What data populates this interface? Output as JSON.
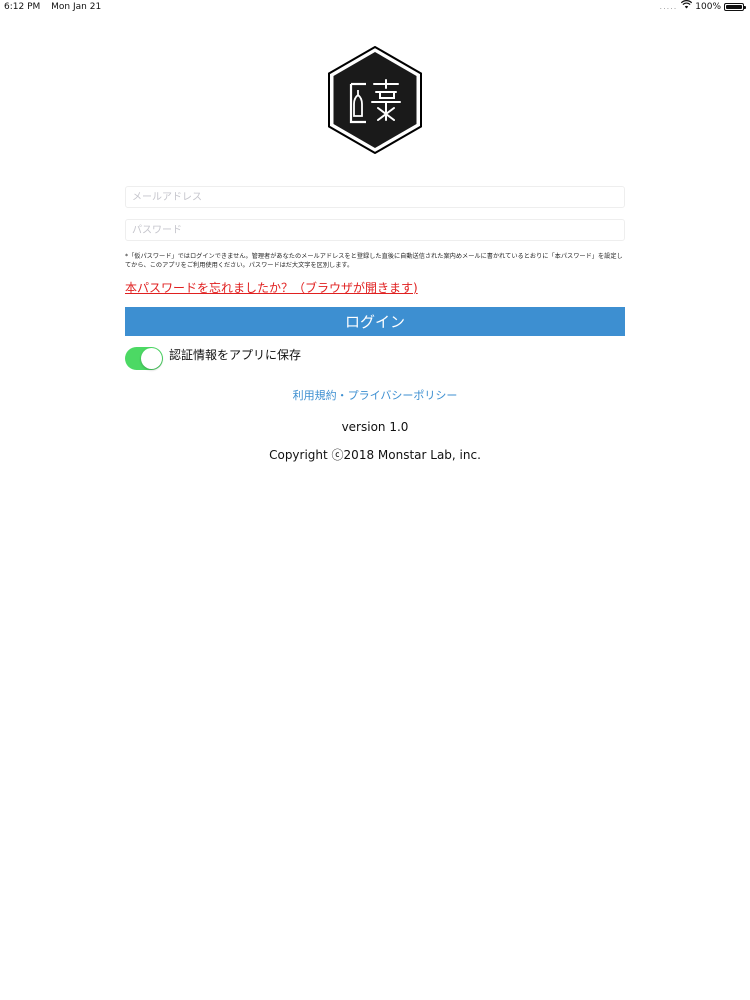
{
  "status_bar": {
    "time": "6:12 PM",
    "date": "Mon Jan 21",
    "battery": "100%",
    "battery_level": 1.0,
    "wifi_icon": "wifi-icon",
    "signal": "....."
  },
  "logo": {
    "icon": "hexagon-sake-logo"
  },
  "login_form": {
    "email_placeholder": "メールアドレス",
    "email_value": "",
    "password_placeholder": "パスワード",
    "password_value": "",
    "note": "*「仮パスワード」ではログインできません。管理者があなたのメールアドレスをと登録した直後に自動送信された案内めメールに書かれているとおりに「本パスワード」を設定してから、このアプリをご利用使用ください。パスワードはだ大文字を区別します。",
    "forgot_link": "本パスワードを忘れましたか？（ブラウザが開きます)",
    "login_button": "ログイン",
    "save_credentials_label": "認証情報をアプリに保存",
    "save_credentials_on": true
  },
  "footer": {
    "terms_link": "利用規約・プライバシーポリシー",
    "version": "version 1.0",
    "copyright": "Copyright ⓒ2018 Monstar Lab, inc."
  },
  "colors": {
    "accent_blue": "#3d8fd1",
    "link_red": "#e02020",
    "toggle_green": "#4cd964"
  }
}
